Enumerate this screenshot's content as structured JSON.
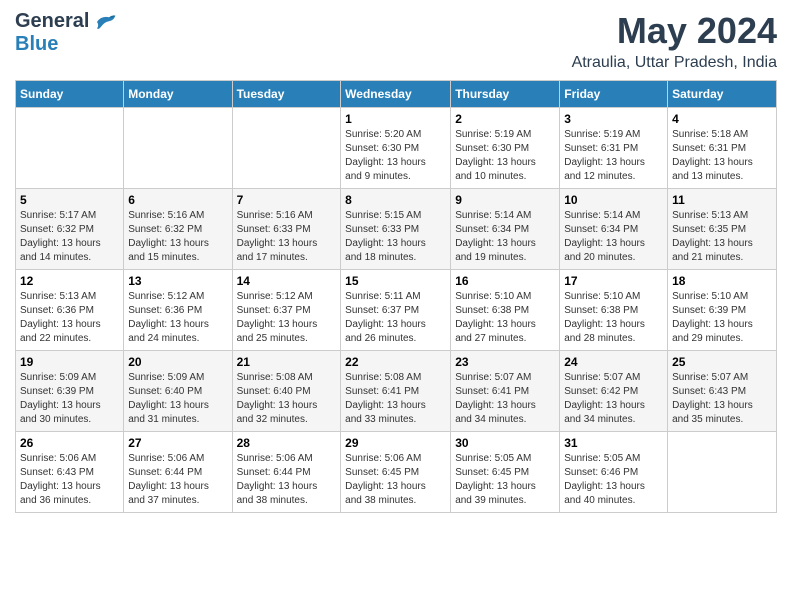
{
  "logo": {
    "general": "General",
    "blue": "Blue"
  },
  "title": "May 2024",
  "subtitle": "Atraulia, Uttar Pradesh, India",
  "days_of_week": [
    "Sunday",
    "Monday",
    "Tuesday",
    "Wednesday",
    "Thursday",
    "Friday",
    "Saturday"
  ],
  "weeks": [
    [
      {
        "day": "",
        "info": ""
      },
      {
        "day": "",
        "info": ""
      },
      {
        "day": "",
        "info": ""
      },
      {
        "day": "1",
        "info": "Sunrise: 5:20 AM\nSunset: 6:30 PM\nDaylight: 13 hours\nand 9 minutes."
      },
      {
        "day": "2",
        "info": "Sunrise: 5:19 AM\nSunset: 6:30 PM\nDaylight: 13 hours\nand 10 minutes."
      },
      {
        "day": "3",
        "info": "Sunrise: 5:19 AM\nSunset: 6:31 PM\nDaylight: 13 hours\nand 12 minutes."
      },
      {
        "day": "4",
        "info": "Sunrise: 5:18 AM\nSunset: 6:31 PM\nDaylight: 13 hours\nand 13 minutes."
      }
    ],
    [
      {
        "day": "5",
        "info": "Sunrise: 5:17 AM\nSunset: 6:32 PM\nDaylight: 13 hours\nand 14 minutes."
      },
      {
        "day": "6",
        "info": "Sunrise: 5:16 AM\nSunset: 6:32 PM\nDaylight: 13 hours\nand 15 minutes."
      },
      {
        "day": "7",
        "info": "Sunrise: 5:16 AM\nSunset: 6:33 PM\nDaylight: 13 hours\nand 17 minutes."
      },
      {
        "day": "8",
        "info": "Sunrise: 5:15 AM\nSunset: 6:33 PM\nDaylight: 13 hours\nand 18 minutes."
      },
      {
        "day": "9",
        "info": "Sunrise: 5:14 AM\nSunset: 6:34 PM\nDaylight: 13 hours\nand 19 minutes."
      },
      {
        "day": "10",
        "info": "Sunrise: 5:14 AM\nSunset: 6:34 PM\nDaylight: 13 hours\nand 20 minutes."
      },
      {
        "day": "11",
        "info": "Sunrise: 5:13 AM\nSunset: 6:35 PM\nDaylight: 13 hours\nand 21 minutes."
      }
    ],
    [
      {
        "day": "12",
        "info": "Sunrise: 5:13 AM\nSunset: 6:36 PM\nDaylight: 13 hours\nand 22 minutes."
      },
      {
        "day": "13",
        "info": "Sunrise: 5:12 AM\nSunset: 6:36 PM\nDaylight: 13 hours\nand 24 minutes."
      },
      {
        "day": "14",
        "info": "Sunrise: 5:12 AM\nSunset: 6:37 PM\nDaylight: 13 hours\nand 25 minutes."
      },
      {
        "day": "15",
        "info": "Sunrise: 5:11 AM\nSunset: 6:37 PM\nDaylight: 13 hours\nand 26 minutes."
      },
      {
        "day": "16",
        "info": "Sunrise: 5:10 AM\nSunset: 6:38 PM\nDaylight: 13 hours\nand 27 minutes."
      },
      {
        "day": "17",
        "info": "Sunrise: 5:10 AM\nSunset: 6:38 PM\nDaylight: 13 hours\nand 28 minutes."
      },
      {
        "day": "18",
        "info": "Sunrise: 5:10 AM\nSunset: 6:39 PM\nDaylight: 13 hours\nand 29 minutes."
      }
    ],
    [
      {
        "day": "19",
        "info": "Sunrise: 5:09 AM\nSunset: 6:39 PM\nDaylight: 13 hours\nand 30 minutes."
      },
      {
        "day": "20",
        "info": "Sunrise: 5:09 AM\nSunset: 6:40 PM\nDaylight: 13 hours\nand 31 minutes."
      },
      {
        "day": "21",
        "info": "Sunrise: 5:08 AM\nSunset: 6:40 PM\nDaylight: 13 hours\nand 32 minutes."
      },
      {
        "day": "22",
        "info": "Sunrise: 5:08 AM\nSunset: 6:41 PM\nDaylight: 13 hours\nand 33 minutes."
      },
      {
        "day": "23",
        "info": "Sunrise: 5:07 AM\nSunset: 6:41 PM\nDaylight: 13 hours\nand 34 minutes."
      },
      {
        "day": "24",
        "info": "Sunrise: 5:07 AM\nSunset: 6:42 PM\nDaylight: 13 hours\nand 34 minutes."
      },
      {
        "day": "25",
        "info": "Sunrise: 5:07 AM\nSunset: 6:43 PM\nDaylight: 13 hours\nand 35 minutes."
      }
    ],
    [
      {
        "day": "26",
        "info": "Sunrise: 5:06 AM\nSunset: 6:43 PM\nDaylight: 13 hours\nand 36 minutes."
      },
      {
        "day": "27",
        "info": "Sunrise: 5:06 AM\nSunset: 6:44 PM\nDaylight: 13 hours\nand 37 minutes."
      },
      {
        "day": "28",
        "info": "Sunrise: 5:06 AM\nSunset: 6:44 PM\nDaylight: 13 hours\nand 38 minutes."
      },
      {
        "day": "29",
        "info": "Sunrise: 5:06 AM\nSunset: 6:45 PM\nDaylight: 13 hours\nand 38 minutes."
      },
      {
        "day": "30",
        "info": "Sunrise: 5:05 AM\nSunset: 6:45 PM\nDaylight: 13 hours\nand 39 minutes."
      },
      {
        "day": "31",
        "info": "Sunrise: 5:05 AM\nSunset: 6:46 PM\nDaylight: 13 hours\nand 40 minutes."
      },
      {
        "day": "",
        "info": ""
      }
    ]
  ]
}
